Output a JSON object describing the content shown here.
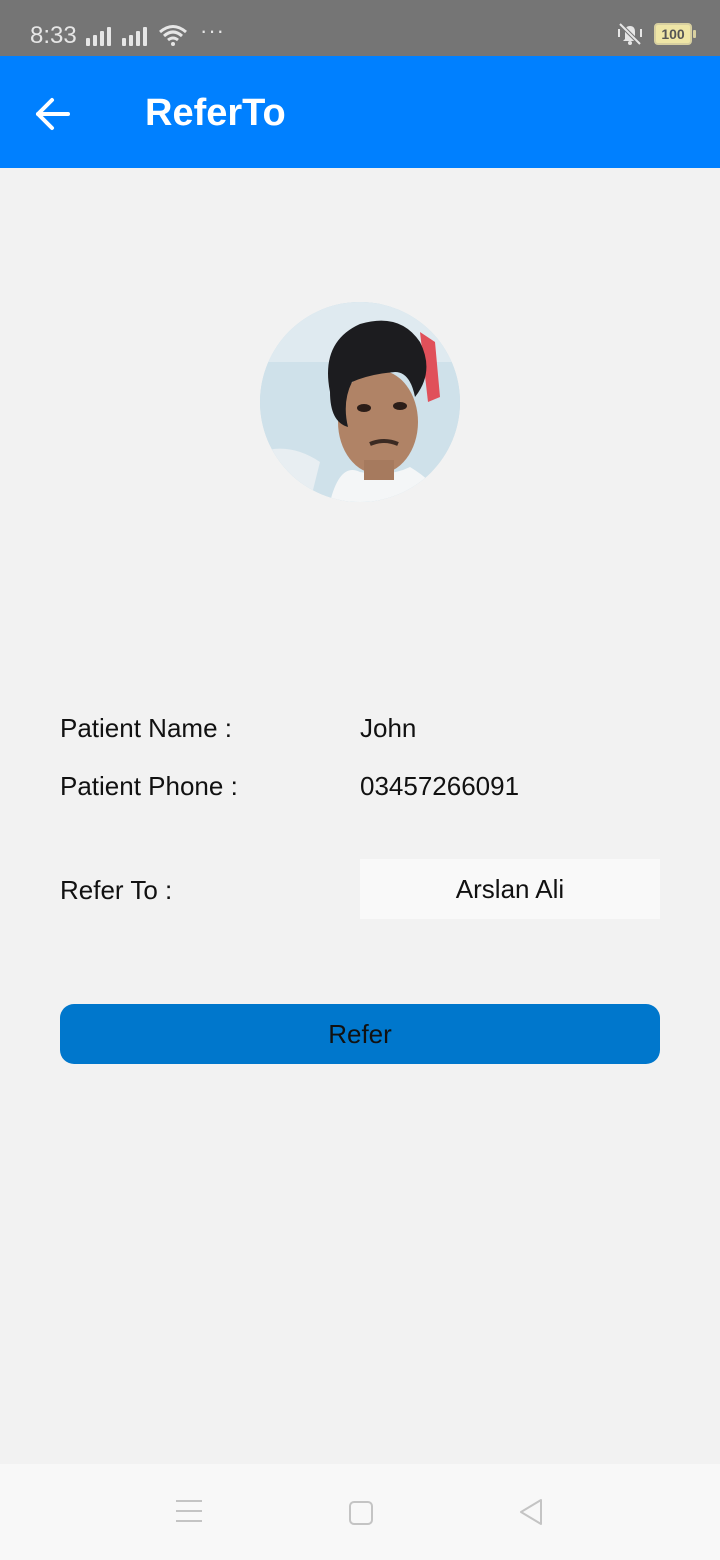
{
  "status_bar": {
    "time": "8:33",
    "more": "···",
    "battery": "100",
    "icons": [
      "signal-icon",
      "signal-icon",
      "wifi-icon",
      "vibrate-icon",
      "battery-icon"
    ]
  },
  "app_bar": {
    "title": "ReferTo",
    "back_icon": "arrow-left-icon"
  },
  "patient": {
    "name_label": "Patient Name :",
    "name_value": "John",
    "phone_label": "Patient Phone :",
    "phone_value": "03457266091"
  },
  "refer": {
    "label": "Refer To :",
    "selected": "Arslan Ali",
    "button_label": "Refer"
  },
  "nav_bar": {
    "icons": [
      "menu-icon",
      "home-icon",
      "back-icon"
    ]
  },
  "colors": {
    "app_bar": "#0080ff",
    "button": "#0077cc",
    "background": "#f2f2f2",
    "status_bar": "#757575"
  }
}
